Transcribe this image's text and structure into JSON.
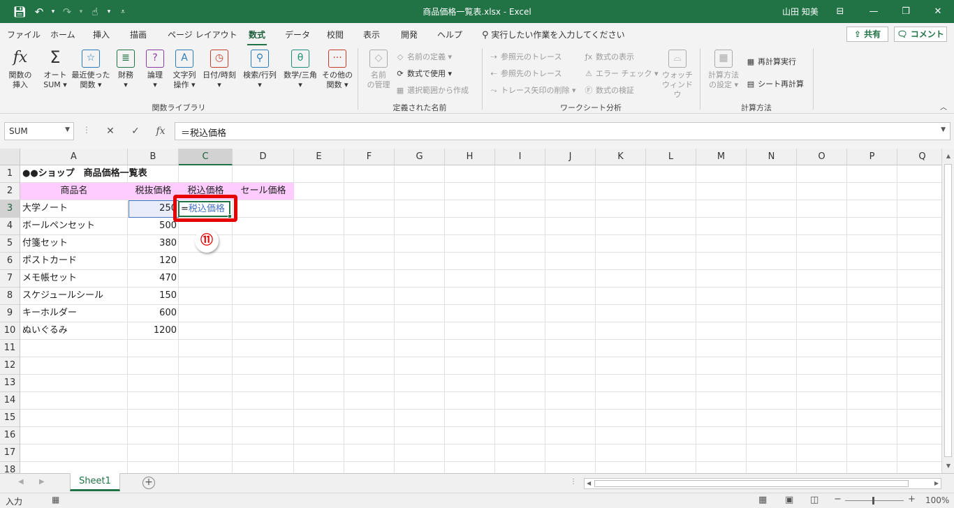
{
  "titlebar": {
    "title": "商品価格一覧表.xlsx  -  Excel",
    "user": "山田 知美",
    "qat_icons": [
      "save-icon",
      "undo-icon",
      "redo-icon",
      "touch-mode-icon",
      "customize-icon"
    ]
  },
  "tabs": [
    "ファイル",
    "ホーム",
    "挿入",
    "描画",
    "ページ レイアウト",
    "数式",
    "データ",
    "校閲",
    "表示",
    "開発",
    "ヘルプ"
  ],
  "active_tab": "数式",
  "tellme": "実行したい作業を入力してください",
  "share_label": "共有",
  "comment_label": "コメント",
  "ribbon": {
    "function_library": {
      "label": "関数ライブラリ",
      "insert_fn": [
        "関数の",
        "挿入"
      ],
      "autosum": [
        "オート",
        "SUM ▾"
      ],
      "recent": [
        "最近使った",
        "関数 ▾"
      ],
      "financial": [
        "財務",
        "▾"
      ],
      "logical": [
        "論理",
        "▾"
      ],
      "text": [
        "文字列",
        "操作 ▾"
      ],
      "datetime": [
        "日付/時刻",
        "▾"
      ],
      "lookup": [
        "検索/行列",
        "▾"
      ],
      "math": [
        "数学/三角",
        "▾"
      ],
      "more": [
        "その他の",
        "関数 ▾"
      ]
    },
    "defined_names": {
      "label": "定義された名前",
      "name_manager": [
        "名前",
        "の管理"
      ],
      "define_name": "名前の定義 ▾",
      "use_in_formula": "数式で使用 ▾",
      "create_from_selection": "選択範囲から作成"
    },
    "formula_auditing": {
      "label": "ワークシート分析",
      "trace_precedents": "参照元のトレース",
      "trace_dependents": "参照先のトレース",
      "remove_arrows": "トレース矢印の削除 ▾",
      "show_formulas": "数式の表示",
      "error_checking": "エラー チェック ▾",
      "evaluate_formula": "数式の検証",
      "watch_window": [
        "ウォッチ",
        "ウィンドウ"
      ]
    },
    "calculation": {
      "label": "計算方法",
      "options": [
        "計算方法",
        "の設定 ▾"
      ],
      "calc_now": "再計算実行",
      "calc_sheet": "シート再計算"
    }
  },
  "namebox": "SUM",
  "formula": "＝税込価格",
  "columns": [
    "A",
    "B",
    "C",
    "D",
    "E",
    "F",
    "G",
    "H",
    "I",
    "J",
    "K",
    "L",
    "M",
    "N",
    "O",
    "P",
    "Q"
  ],
  "rows": [
    "1",
    "2",
    "3",
    "4",
    "5",
    "6",
    "7",
    "8",
    "9",
    "10",
    "11",
    "12",
    "13",
    "14",
    "15",
    "16",
    "17",
    "18"
  ],
  "cells": {
    "A1": "●●ショップ　商品価格一覧表",
    "A2": "商品名",
    "B2": "税抜価格",
    "C2": "税込価格",
    "D2": "セール価格",
    "items": [
      {
        "name": "大学ノート",
        "price": "250"
      },
      {
        "name": "ボールペンセット",
        "price": "500"
      },
      {
        "name": "付箋セット",
        "price": "380"
      },
      {
        "name": "ポストカード",
        "price": "120"
      },
      {
        "name": "メモ帳セット",
        "price": "470"
      },
      {
        "name": "スケジュールシール",
        "price": "150"
      },
      {
        "name": "キーホルダー",
        "price": "600"
      },
      {
        "name": "ぬいぐるみ",
        "price": "1200"
      }
    ],
    "C3_prefix": "=",
    "C3_ref": "税込価格"
  },
  "step_badge": "⑪",
  "sheet_tab": "Sheet1",
  "status_mode": "入力",
  "zoom": "100%",
  "colors": {
    "accent": "#217346",
    "highlight_pink": "#ffccff",
    "ref_blue": "#4472c4",
    "callout_red": "#e60000"
  }
}
